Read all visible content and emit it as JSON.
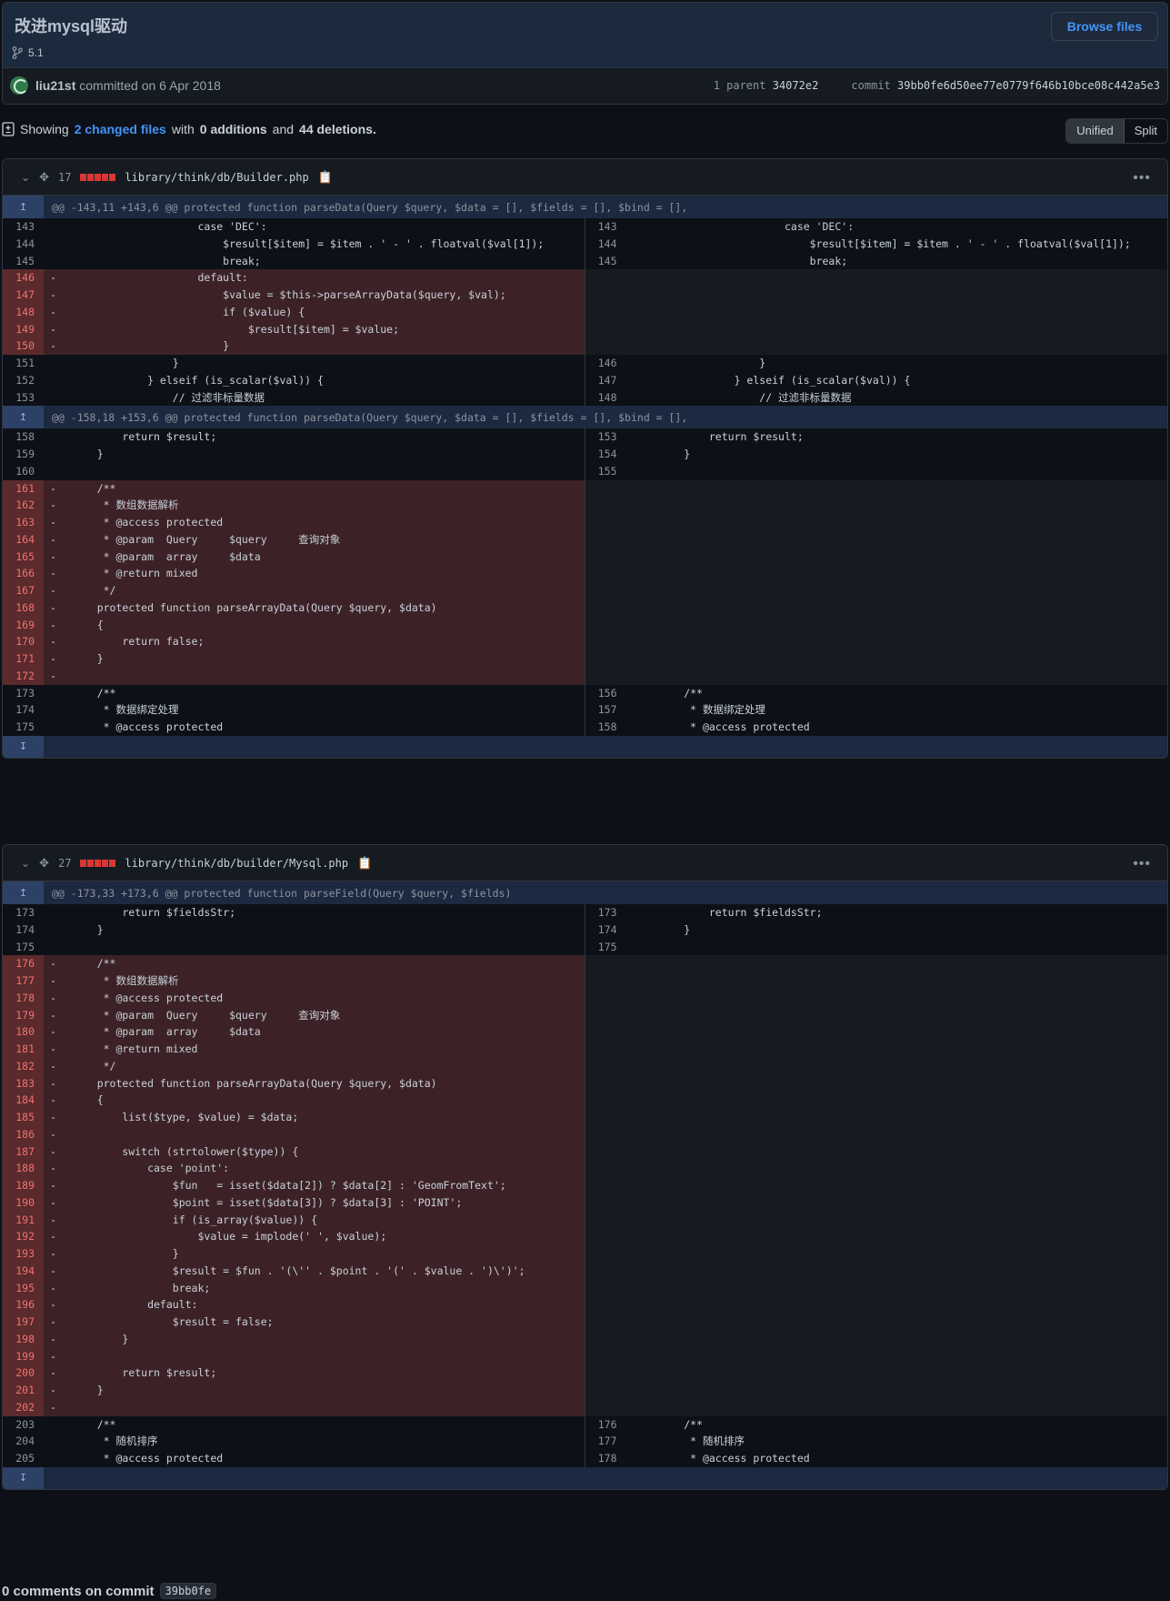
{
  "commit": {
    "title": "改进mysql驱动",
    "branch": "5.1",
    "browse_label": "Browse files",
    "author": "liu21st",
    "committed_text": "committed on 6 Apr 2018",
    "parent_label": "1 parent",
    "parent_sha": "34072e2",
    "commit_label": "commit",
    "commit_sha": "39bb0fe6d50ee77e0779f646b10bce08c442a5e3"
  },
  "summary": {
    "showing": "Showing",
    "changed_files": "2 changed files",
    "with": "with",
    "additions": "0 additions",
    "and": "and",
    "deletions": "44 deletions."
  },
  "view_toggle": {
    "unified": "Unified",
    "split": "Split"
  },
  "files": [
    {
      "count": "17",
      "path": "library/think/db/Builder.php",
      "rows": [
        {
          "type": "hunk",
          "text": "@@ -143,11 +143,6 @@ protected function parseData(Query $query, $data = [], $fields = [], $bind = [],"
        },
        {
          "type": "ctx",
          "ln": "143",
          "rn": "143",
          "code": "                    case 'DEC':"
        },
        {
          "type": "ctx",
          "ln": "144",
          "rn": "144",
          "code": "                        $result[$item] = $item . ' - ' . floatval($val[1]);"
        },
        {
          "type": "ctx",
          "ln": "145",
          "rn": "145",
          "code": "                        break;"
        },
        {
          "type": "del",
          "ln": "146",
          "code": "                    default:"
        },
        {
          "type": "del",
          "ln": "147",
          "code": "                        $value = $this->parseArrayData($query, $val);"
        },
        {
          "type": "del",
          "ln": "148",
          "code": "                        if ($value) {"
        },
        {
          "type": "del",
          "ln": "149",
          "code": "                            $result[$item] = $value;"
        },
        {
          "type": "del",
          "ln": "150",
          "code": "                        }"
        },
        {
          "type": "ctx",
          "ln": "151",
          "rn": "146",
          "code": "                }"
        },
        {
          "type": "ctx",
          "ln": "152",
          "rn": "147",
          "code": "            } elseif (is_scalar($val)) {"
        },
        {
          "type": "ctx",
          "ln": "153",
          "rn": "148",
          "code": "                // 过滤非标量数据"
        },
        {
          "type": "hunk",
          "text": "@@ -158,18 +153,6 @@ protected function parseData(Query $query, $data = [], $fields = [], $bind = [],"
        },
        {
          "type": "ctx",
          "ln": "158",
          "rn": "153",
          "code": "        return $result;"
        },
        {
          "type": "ctx",
          "ln": "159",
          "rn": "154",
          "code": "    }"
        },
        {
          "type": "ctx",
          "ln": "160",
          "rn": "155",
          "code": ""
        },
        {
          "type": "del",
          "ln": "161",
          "code": "    /**"
        },
        {
          "type": "del",
          "ln": "162",
          "code": "     * 数组数据解析"
        },
        {
          "type": "del",
          "ln": "163",
          "code": "     * @access protected"
        },
        {
          "type": "del",
          "ln": "164",
          "code": "     * @param  Query     $query     查询对象"
        },
        {
          "type": "del",
          "ln": "165",
          "code": "     * @param  array     $data"
        },
        {
          "type": "del",
          "ln": "166",
          "code": "     * @return mixed"
        },
        {
          "type": "del",
          "ln": "167",
          "code": "     */"
        },
        {
          "type": "del",
          "ln": "168",
          "code": "    protected function parseArrayData(Query $query, $data)"
        },
        {
          "type": "del",
          "ln": "169",
          "code": "    {"
        },
        {
          "type": "del",
          "ln": "170",
          "code": "        return false;"
        },
        {
          "type": "del",
          "ln": "171",
          "code": "    }"
        },
        {
          "type": "del",
          "ln": "172",
          "code": ""
        },
        {
          "type": "ctx",
          "ln": "173",
          "rn": "156",
          "code": "    /**"
        },
        {
          "type": "ctx",
          "ln": "174",
          "rn": "157",
          "code": "     * 数据绑定处理"
        },
        {
          "type": "ctx",
          "ln": "175",
          "rn": "158",
          "code": "     * @access protected"
        }
      ]
    },
    {
      "count": "27",
      "path": "library/think/db/builder/Mysql.php",
      "rows": [
        {
          "type": "hunk",
          "text": "@@ -173,33 +173,6 @@ protected function parseField(Query $query, $fields)"
        },
        {
          "type": "ctx",
          "ln": "173",
          "rn": "173",
          "code": "        return $fieldsStr;"
        },
        {
          "type": "ctx",
          "ln": "174",
          "rn": "174",
          "code": "    }"
        },
        {
          "type": "ctx",
          "ln": "175",
          "rn": "175",
          "code": ""
        },
        {
          "type": "del",
          "ln": "176",
          "code": "    /**"
        },
        {
          "type": "del",
          "ln": "177",
          "code": "     * 数组数据解析"
        },
        {
          "type": "del",
          "ln": "178",
          "code": "     * @access protected"
        },
        {
          "type": "del",
          "ln": "179",
          "code": "     * @param  Query     $query     查询对象"
        },
        {
          "type": "del",
          "ln": "180",
          "code": "     * @param  array     $data"
        },
        {
          "type": "del",
          "ln": "181",
          "code": "     * @return mixed"
        },
        {
          "type": "del",
          "ln": "182",
          "code": "     */"
        },
        {
          "type": "del",
          "ln": "183",
          "code": "    protected function parseArrayData(Query $query, $data)"
        },
        {
          "type": "del",
          "ln": "184",
          "code": "    {"
        },
        {
          "type": "del",
          "ln": "185",
          "code": "        list($type, $value) = $data;"
        },
        {
          "type": "del",
          "ln": "186",
          "code": ""
        },
        {
          "type": "del",
          "ln": "187",
          "code": "        switch (strtolower($type)) {"
        },
        {
          "type": "del",
          "ln": "188",
          "code": "            case 'point':"
        },
        {
          "type": "del",
          "ln": "189",
          "code": "                $fun   = isset($data[2]) ? $data[2] : 'GeomFromText';"
        },
        {
          "type": "del",
          "ln": "190",
          "code": "                $point = isset($data[3]) ? $data[3] : 'POINT';"
        },
        {
          "type": "del",
          "ln": "191",
          "code": "                if (is_array($value)) {"
        },
        {
          "type": "del",
          "ln": "192",
          "code": "                    $value = implode(' ', $value);"
        },
        {
          "type": "del",
          "ln": "193",
          "code": "                }"
        },
        {
          "type": "del",
          "ln": "194",
          "code": "                $result = $fun . '(\\'' . $point . '(' . $value . ')\\')';"
        },
        {
          "type": "del",
          "ln": "195",
          "code": "                break;"
        },
        {
          "type": "del",
          "ln": "196",
          "code": "            default:"
        },
        {
          "type": "del",
          "ln": "197",
          "code": "                $result = false;"
        },
        {
          "type": "del",
          "ln": "198",
          "code": "        }"
        },
        {
          "type": "del",
          "ln": "199",
          "code": ""
        },
        {
          "type": "del",
          "ln": "200",
          "code": "        return $result;"
        },
        {
          "type": "del",
          "ln": "201",
          "code": "    }"
        },
        {
          "type": "del",
          "ln": "202",
          "code": ""
        },
        {
          "type": "ctx",
          "ln": "203",
          "rn": "176",
          "code": "    /**"
        },
        {
          "type": "ctx",
          "ln": "204",
          "rn": "177",
          "code": "     * 随机排序"
        },
        {
          "type": "ctx",
          "ln": "205",
          "rn": "178",
          "code": "     * @access protected"
        }
      ]
    }
  ],
  "comments": {
    "text": "0 comments on commit",
    "sha": "39bb0fe"
  },
  "icons": [
    "branch-icon",
    "avatar",
    "diff-file-icon",
    "chevron-down-icon",
    "expand-icon",
    "clipboard-icon",
    "kebab-icon",
    "expand-up-icon",
    "expand-down-icon"
  ],
  "colors": {
    "deletion_bg": "#3c2227",
    "deletion_num_bg": "#5a2a2c",
    "hunk_bg": "#1c2940",
    "accent": "#4493f8"
  }
}
